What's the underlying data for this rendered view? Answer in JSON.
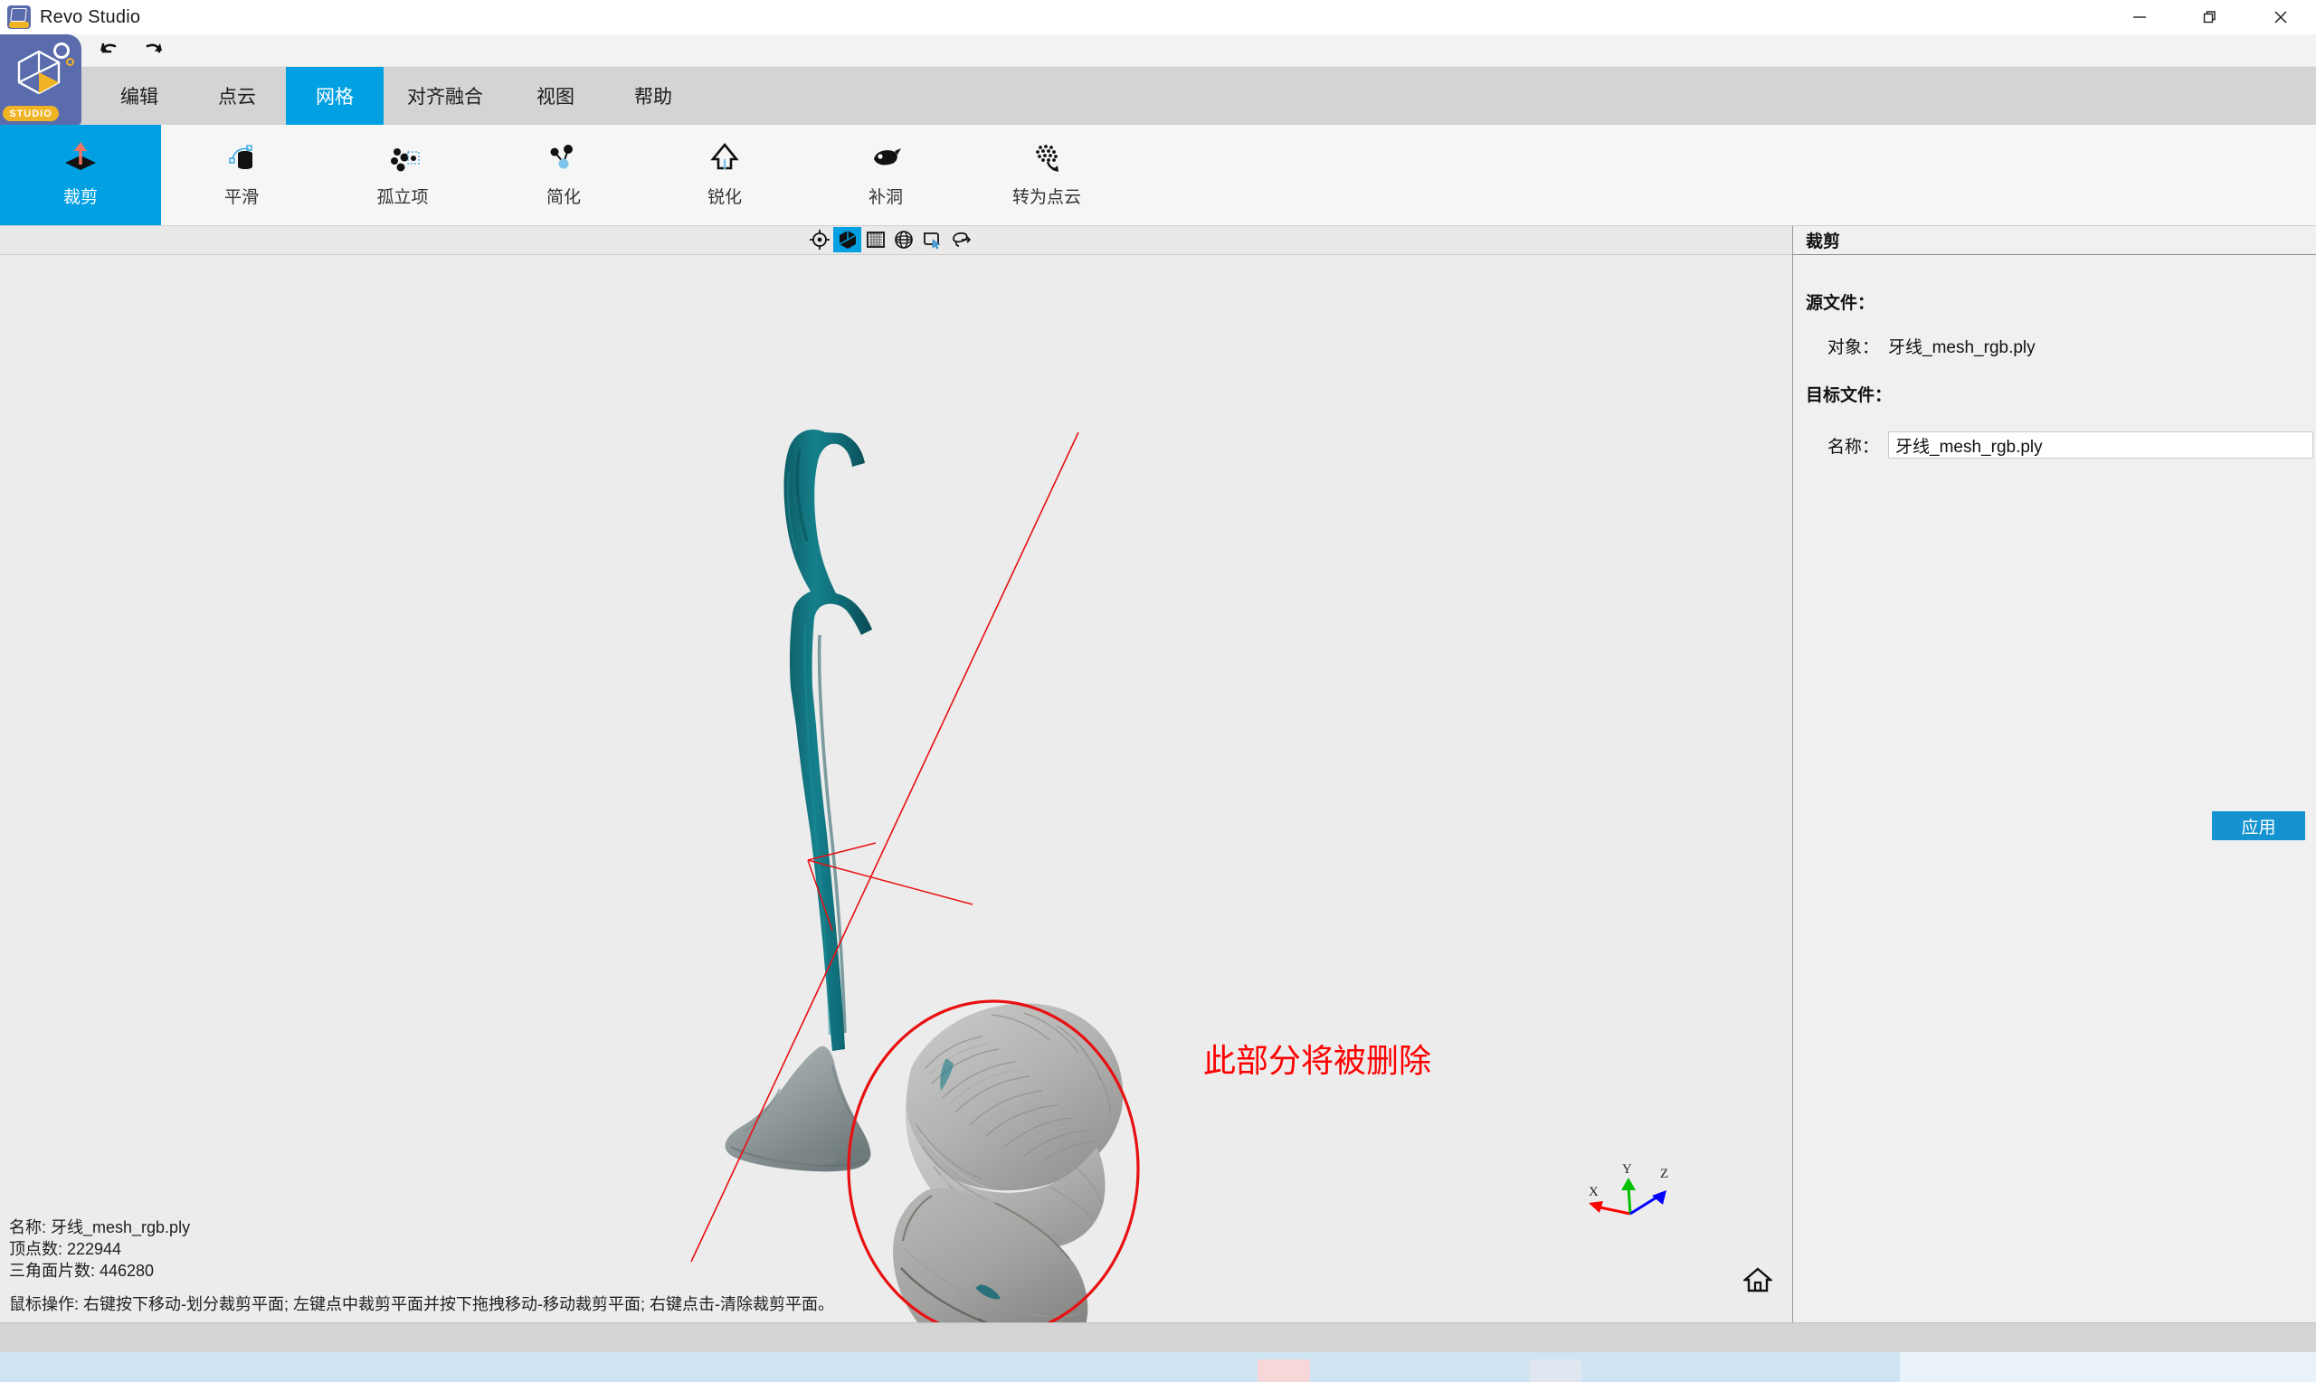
{
  "window": {
    "title": "Revo Studio",
    "icon": "app-logo-icon",
    "minimize": "—",
    "restore": "❐",
    "close": "✕",
    "logo_badge": "STUDIO"
  },
  "quick_access": {
    "undo_label": "↶",
    "redo_label": "↷"
  },
  "menubar": {
    "items": [
      {
        "label": "编辑",
        "active": false
      },
      {
        "label": "点云",
        "active": false
      },
      {
        "label": "网格",
        "active": true
      },
      {
        "label": "对齐融合",
        "active": false
      },
      {
        "label": "视图",
        "active": false
      },
      {
        "label": "帮助",
        "active": false
      }
    ]
  },
  "ribbon": {
    "items": [
      {
        "label": "裁剪",
        "icon": "crop-plane-icon",
        "active": true
      },
      {
        "label": "平滑",
        "icon": "smooth-icon",
        "active": false
      },
      {
        "label": "孤立项",
        "icon": "isolated-items-icon",
        "active": false
      },
      {
        "label": "简化",
        "icon": "simplify-icon",
        "active": false
      },
      {
        "label": "锐化",
        "icon": "sharpen-icon",
        "active": false
      },
      {
        "label": "补洞",
        "icon": "fill-hole-icon",
        "active": false
      },
      {
        "label": "转为点云",
        "icon": "to-pointcloud-icon",
        "active": false
      }
    ]
  },
  "viewport_toolbar": {
    "tools": [
      {
        "name": "target-center-icon",
        "active": false
      },
      {
        "name": "shaded-cube-icon",
        "active": true
      },
      {
        "name": "mesh-grid-icon",
        "active": false
      },
      {
        "name": "wireframe-globe-icon",
        "active": false
      },
      {
        "name": "rectangle-select-icon",
        "active": false
      },
      {
        "name": "lasso-select-icon",
        "active": false
      }
    ]
  },
  "viewport": {
    "annotation": "此部分将被删除",
    "annotation_color": "#ff0000",
    "axis": {
      "x": "X",
      "y": "Y",
      "z": "Z",
      "x_color": "#ff0000",
      "y_color": "#00c000",
      "z_color": "#0000ff"
    },
    "home_icon": "home-icon",
    "status": {
      "name_line": "名称:  牙线_mesh_rgb.ply",
      "vertices_line": "顶点数:  222944",
      "triangles_line": "三角面片数:  446280",
      "hint_line": "鼠标操作:  右键按下移动-划分裁剪平面;  左键点中裁剪平面并按下拖拽移动-移动裁剪平面;  右键点击-清除裁剪平面。"
    }
  },
  "right_panel": {
    "title": "裁剪",
    "source_section_label": "源文件：",
    "object_label": "对象：",
    "object_value": "牙线_mesh_rgb.ply",
    "target_section_label": "目标文件：",
    "name_label": "名称：",
    "name_value": "牙线_mesh_rgb.ply",
    "apply_label": "应用",
    "accent_color": "#1592d0"
  }
}
